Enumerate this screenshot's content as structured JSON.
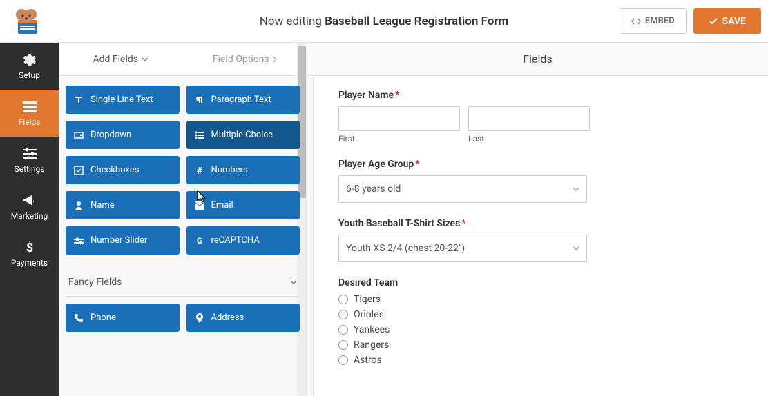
{
  "header": {
    "prefix": "Now editing",
    "title": "Baseball League Registration Form",
    "embed": "EMBED",
    "save": "SAVE"
  },
  "sidebar": {
    "setup": "Setup",
    "fields": "Fields",
    "settings": "Settings",
    "marketing": "Marketing",
    "payments": "Payments"
  },
  "panel": {
    "tab_add": "Add Fields",
    "tab_options": "Field Options",
    "section_fancy": "Fancy Fields"
  },
  "field_buttons": {
    "single_line": "Single Line Text",
    "paragraph": "Paragraph Text",
    "dropdown": "Dropdown",
    "multiple_choice": "Multiple Choice",
    "checkboxes": "Checkboxes",
    "numbers": "Numbers",
    "name": "Name",
    "email": "Email",
    "number_slider": "Number Slider",
    "recaptcha": "reCAPTCHA",
    "phone": "Phone",
    "address": "Address"
  },
  "content": {
    "heading": "Fields"
  },
  "form": {
    "player_name": "Player Name",
    "first": "First",
    "last": "Last",
    "age_group": "Player Age Group",
    "age_value": "6-8 years old",
    "tshirt": "Youth Baseball T-Shirt Sizes",
    "tshirt_value": "Youth XS  2/4 (chest 20-22\")",
    "desired_team": "Desired Team",
    "teams": [
      "Tigers",
      "Orioles",
      "Yankees",
      "Rangers",
      "Astros"
    ]
  }
}
